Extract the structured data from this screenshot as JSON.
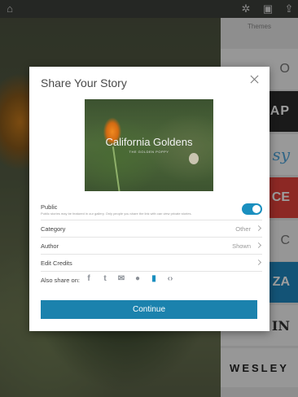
{
  "background": {
    "themes_label": "Themes",
    "tiles": [
      "O",
      "CAP",
      "sy",
      "CE",
      "C",
      "ZA",
      "IN",
      "WESLEY"
    ]
  },
  "modal": {
    "title": "Share Your Story",
    "cover": {
      "title": "California Goldens",
      "subtitle": "THE GOLDEN POPPY"
    },
    "public": {
      "label": "Public",
      "description": "Public stories may be featured in our gallery. Only people you share the link with can view private stories.",
      "enabled": true
    },
    "rows": {
      "category": {
        "label": "Category",
        "value": "Other"
      },
      "author": {
        "label": "Author",
        "value": "Shown"
      },
      "credits": {
        "label": "Edit Credits"
      }
    },
    "share": {
      "label": "Also share on:",
      "icons": [
        "facebook-icon",
        "twitter-icon",
        "email-icon",
        "message-icon",
        "clipboard-icon",
        "embed-icon"
      ]
    },
    "continue_label": "Continue"
  },
  "colors": {
    "accent": "#1b82ad",
    "toggle_on": "#1a8fbf"
  }
}
